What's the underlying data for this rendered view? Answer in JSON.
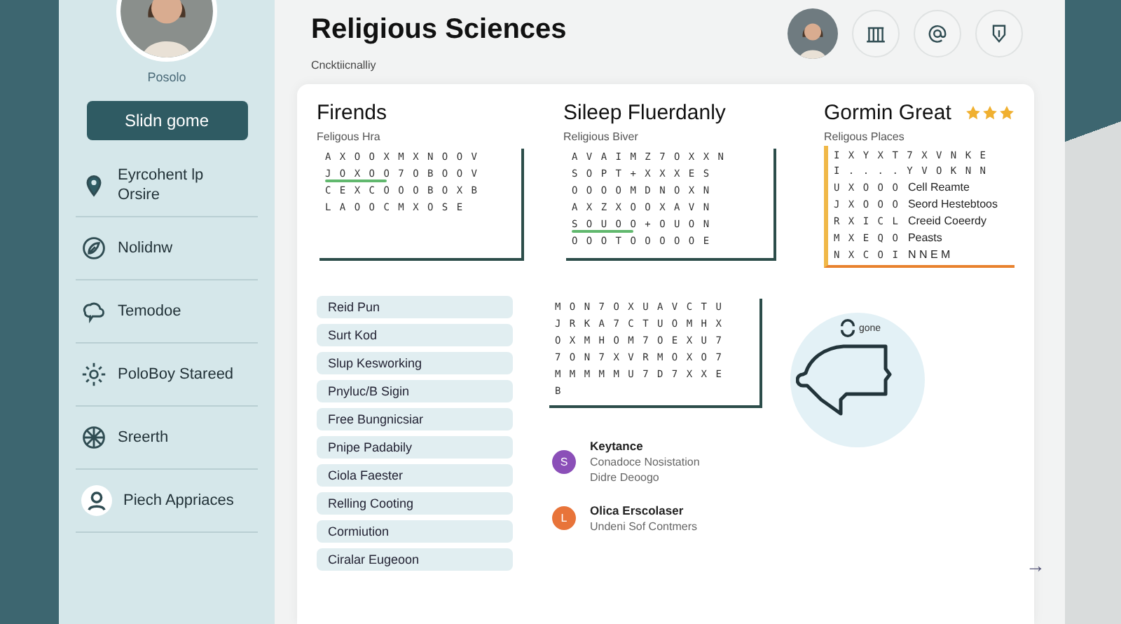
{
  "sidebar": {
    "profile_name": "Posolo",
    "action_button": "Slidn gome",
    "items": [
      {
        "kind": "pin",
        "label": "Eyrcohent lp Orsire"
      },
      {
        "kind": "leaf",
        "label": "Nolidnw"
      },
      {
        "kind": "cloud",
        "label": "Temodoe"
      },
      {
        "kind": "sun",
        "label": "PoloBoy Stareed"
      },
      {
        "kind": "wheel",
        "label": "Sreerth"
      },
      {
        "kind": "person",
        "label": "Piech Appriaces"
      }
    ]
  },
  "header": {
    "title": "Religious Sciences",
    "subtitle": "Cncktiicnalliy",
    "actions": [
      {
        "kind": "building"
      },
      {
        "kind": "at"
      },
      {
        "kind": "shield"
      }
    ]
  },
  "puzzles": [
    {
      "title": "Firends",
      "subtitle": "Feligous Hra",
      "rows": [
        {
          "letters": "A X O O X M X N O O V"
        },
        {
          "letters": "J O X O O 7 O B O O V",
          "marked": true
        },
        {
          "letters": "C E X C O O O B O X B"
        },
        {
          "letters": "L A O O C M X O S E"
        }
      ]
    },
    {
      "title": "Sileep Fluerdanly",
      "subtitle": "Religious Biver",
      "rows": [
        {
          "letters": "A V A I M Z 7 O X X N"
        },
        {
          "letters": "S O P T + X X X E S"
        },
        {
          "letters": "O O O O M D N O X N"
        },
        {
          "letters": "A X Z X O O X A V N"
        },
        {
          "letters": "S O U O O + O U O N",
          "marked": true
        },
        {
          "letters": "O O O T O O O O O E"
        }
      ]
    },
    {
      "title": "Gormin Great",
      "subtitle": "Religous Places",
      "stars": 3,
      "framed": true,
      "rows": [
        {
          "letters": "I X Y X T 7 X V N K E"
        },
        {
          "letters": "I . . . . Y V O K N N"
        },
        {
          "letters": "U X O O O",
          "clue": "Cell Reamte"
        },
        {
          "letters": "J X O O O",
          "clue": "Seord Hestebtoos"
        },
        {
          "letters": "R X I C L",
          "clue": "Creeid Coeerdy"
        },
        {
          "letters": "M X E Q O",
          "clue": "Peasts"
        },
        {
          "letters": "N X C O I",
          "clue": "N N E M"
        }
      ]
    }
  ],
  "word_list": [
    "Reid Pun",
    "Surt Kod",
    "Slup Kesworking",
    "Pnyluc/B Sigin",
    "Free Bungnicsiar",
    "Pnipe Padabily",
    "Ciola Faester",
    "Relling Cooting",
    "Cormiution",
    "Ciralar Eugeoon"
  ],
  "small_puzzle": {
    "rows": [
      {
        "letters": "M O N 7 O X U A V C T U"
      },
      {
        "letters": "J R K A 7 C T U O M H X"
      },
      {
        "letters": "O X M H O M 7 O E X U 7"
      },
      {
        "letters": "7 O N 7 X V R M O X O 7"
      },
      {
        "letters": "M M M M M U 7 D 7 X X E"
      },
      {
        "letters": "B"
      }
    ]
  },
  "legend": [
    {
      "badge": "S",
      "color": "#8b4fb8",
      "title": "Keytance",
      "lines": [
        "Conadoce Nosistation",
        "Didre Deoogo"
      ]
    },
    {
      "badge": "L",
      "color": "#e8743a",
      "title": "Olica Erscolaser",
      "lines": [
        "Undeni Sof Contmers"
      ]
    }
  ],
  "piggy_caption": "gone",
  "next_arrow": "→"
}
